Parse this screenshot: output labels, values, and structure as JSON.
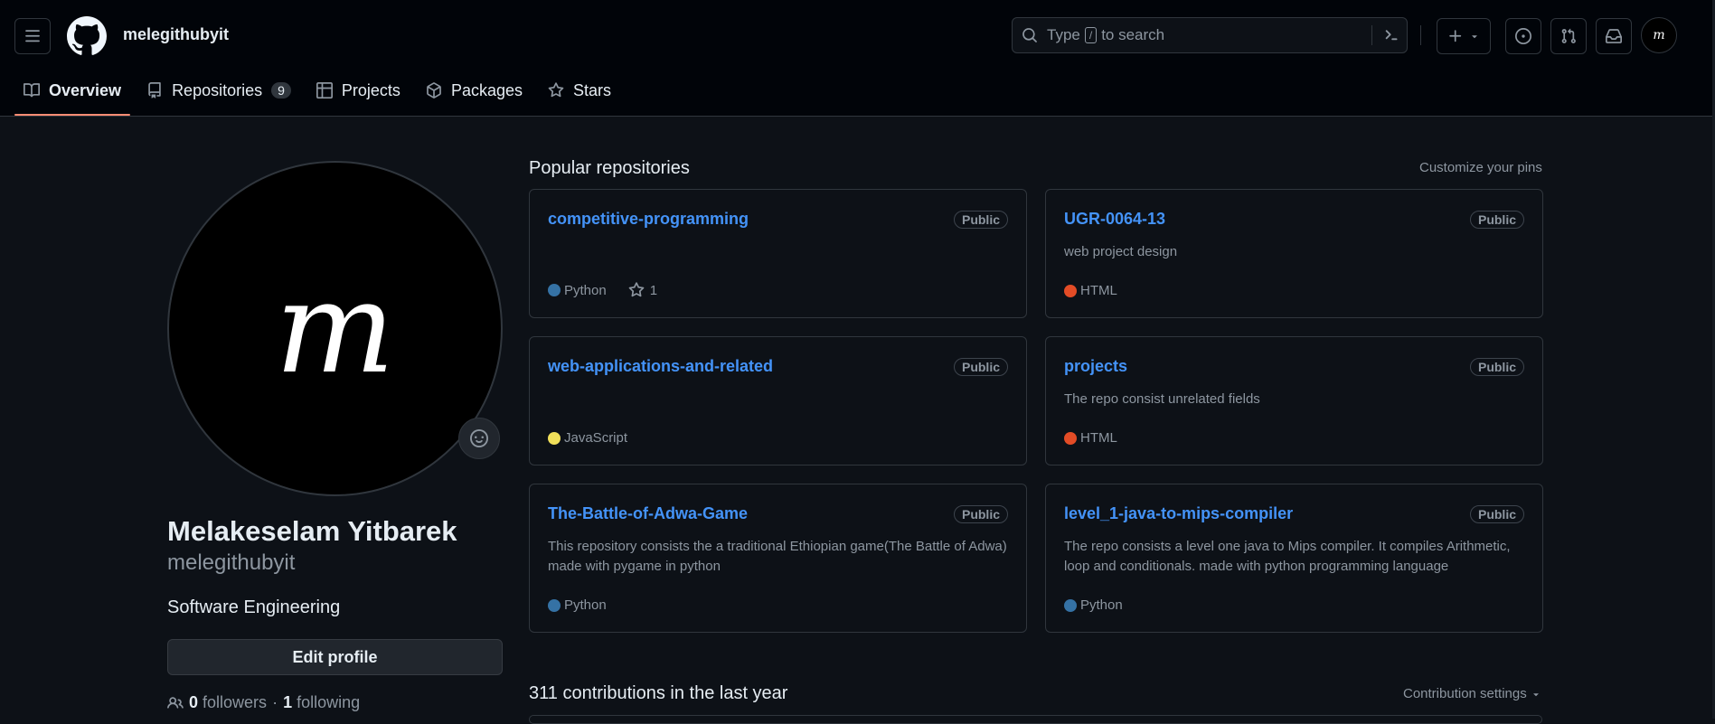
{
  "header": {
    "username": "melegithubyit",
    "search_prefix": "Type",
    "search_key": "/",
    "search_suffix": "to search",
    "avatar_letter": "m"
  },
  "tabs": [
    {
      "label": "Overview",
      "icon": "book-icon",
      "active": true
    },
    {
      "label": "Repositories",
      "icon": "repo-icon",
      "count": "9"
    },
    {
      "label": "Projects",
      "icon": "table-icon"
    },
    {
      "label": "Packages",
      "icon": "package-icon"
    },
    {
      "label": "Stars",
      "icon": "star-icon"
    }
  ],
  "profile": {
    "avatar_letter": "m",
    "full_name": "Melakeselam Yitbarek",
    "login": "melegithubyit",
    "bio": "Software Engineering",
    "edit_label": "Edit profile",
    "followers_count": "0",
    "followers_label": "followers",
    "separator": "·",
    "following_count": "1",
    "following_label": "following"
  },
  "popular": {
    "title": "Popular repositories",
    "customize": "Customize your pins",
    "repos": [
      {
        "name": "competitive-programming",
        "visibility": "Public",
        "description": "",
        "language": "Python",
        "lang_color": "#3572A5",
        "stars": "1"
      },
      {
        "name": "UGR-0064-13",
        "visibility": "Public",
        "description": "web project design",
        "language": "HTML",
        "lang_color": "#e34c26"
      },
      {
        "name": "web-applications-and-related",
        "visibility": "Public",
        "description": "",
        "language": "JavaScript",
        "lang_color": "#f1e05a"
      },
      {
        "name": "projects",
        "visibility": "Public",
        "description": "The repo consist unrelated fields",
        "language": "HTML",
        "lang_color": "#e34c26"
      },
      {
        "name": "The-Battle-of-Adwa-Game",
        "visibility": "Public",
        "description": "This repository consists the a traditional Ethiopian game(The Battle of Adwa) made with pygame in python",
        "language": "Python",
        "lang_color": "#3572A5"
      },
      {
        "name": "level_1-java-to-mips-compiler",
        "visibility": "Public",
        "description": "The repo consists a level one java to Mips compiler. It compiles Arithmetic, loop and conditionals. made with python programming language",
        "language": "Python",
        "lang_color": "#3572A5"
      }
    ]
  },
  "contributions": {
    "title": "311 contributions in the last year",
    "settings": "Contribution settings"
  }
}
